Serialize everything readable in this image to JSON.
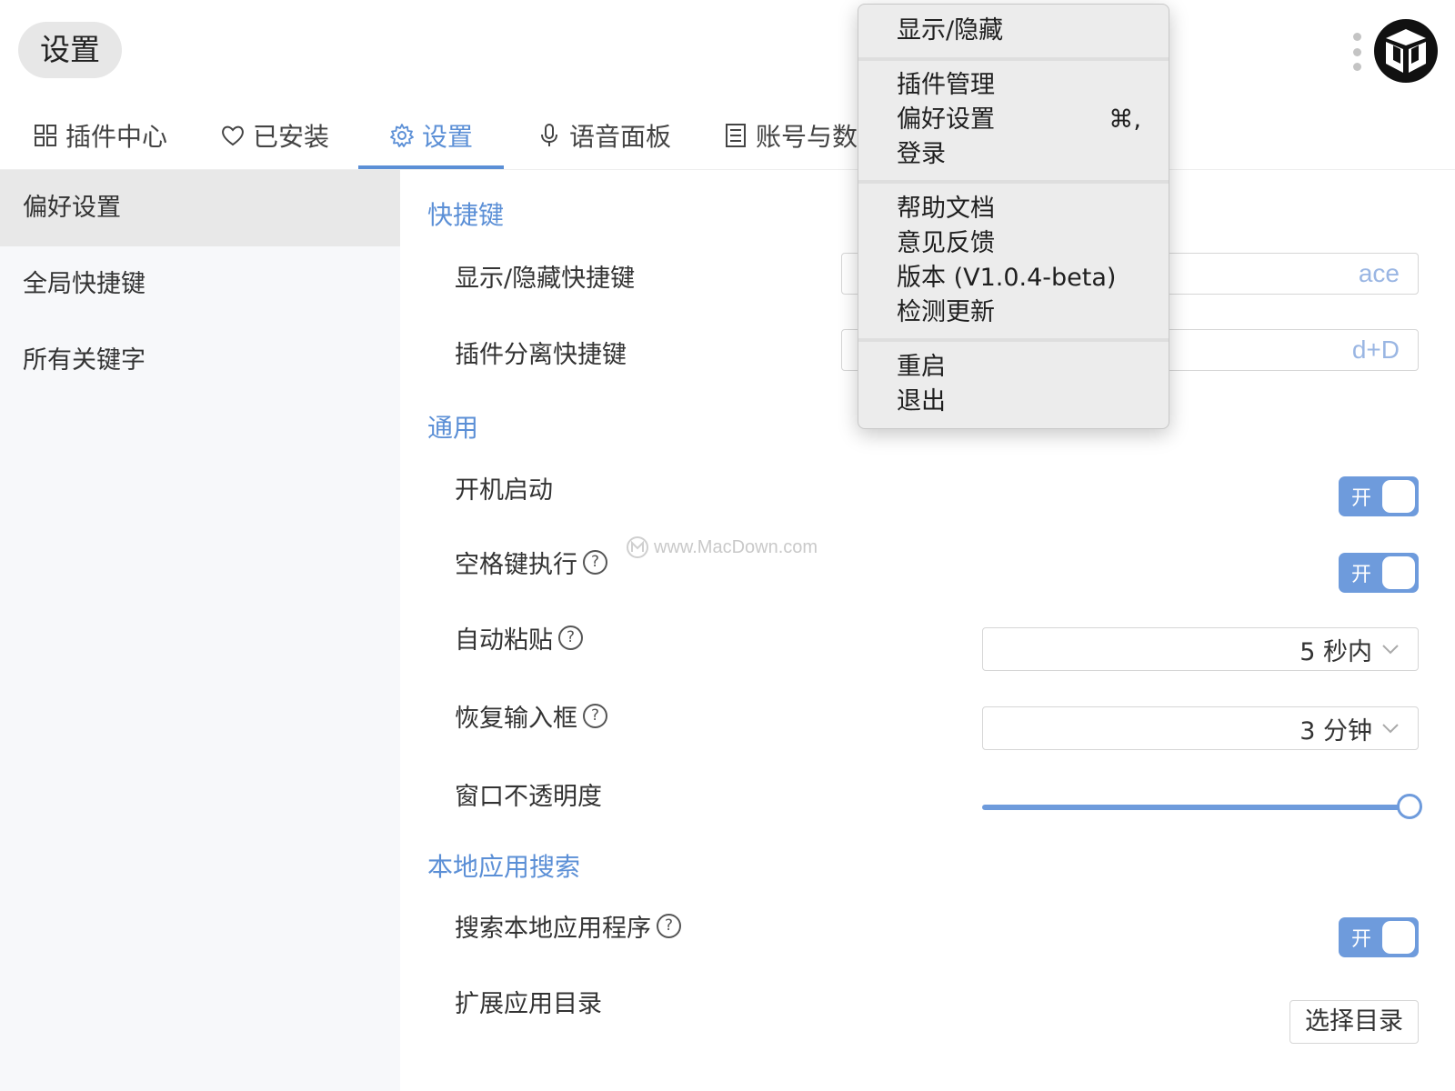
{
  "window": {
    "title": "设置"
  },
  "tabs": [
    {
      "label": "插件中心",
      "icon": "grid-icon"
    },
    {
      "label": "已安装",
      "icon": "heart-icon"
    },
    {
      "label": "设置",
      "icon": "gear-icon",
      "active": true
    },
    {
      "label": "语音面板",
      "icon": "microphone-icon"
    },
    {
      "label": "账号与数",
      "icon": "id-card-icon"
    }
  ],
  "sidebar": {
    "items": [
      {
        "label": "偏好设置",
        "active": true
      },
      {
        "label": "全局快捷键"
      },
      {
        "label": "所有关键字"
      }
    ]
  },
  "sections": {
    "shortcuts": {
      "title": "快捷键",
      "show_hide": {
        "label": "显示/隐藏快捷键",
        "value": "ace"
      },
      "detach": {
        "label": "插件分离快捷键",
        "value": "d+D"
      }
    },
    "general": {
      "title": "通用",
      "autostart": {
        "label": "开机启动",
        "toggle": "开"
      },
      "space_exec": {
        "label": "空格键执行",
        "toggle": "开"
      },
      "auto_paste": {
        "label": "自动粘贴",
        "value": "5 秒内"
      },
      "restore_input": {
        "label": "恢复输入框",
        "value": "3 分钟"
      },
      "opacity": {
        "label": "窗口不透明度",
        "level_percent": 100
      }
    },
    "local_search": {
      "title": "本地应用搜索",
      "search_apps": {
        "label": "搜索本地应用程序",
        "toggle": "开"
      },
      "ext_dir": {
        "label": "扩展应用目录",
        "button": "选择目录"
      }
    }
  },
  "help_glyph": "?",
  "watermark": "www.MacDown.com",
  "menu": {
    "show_hide": "显示/隐藏",
    "plugin_manage": "插件管理",
    "preferences": "偏好设置",
    "preferences_shortcut": "⌘,",
    "login": "登录",
    "help_docs": "帮助文档",
    "feedback": "意见反馈",
    "version": "版本 (V1.0.4-beta)",
    "check_update": "检测更新",
    "restart": "重启",
    "quit": "退出"
  },
  "colors": {
    "accent": "#5b8fd6",
    "toggle": "#6e9bdc",
    "sidebar_bg": "#f7f8fa"
  }
}
